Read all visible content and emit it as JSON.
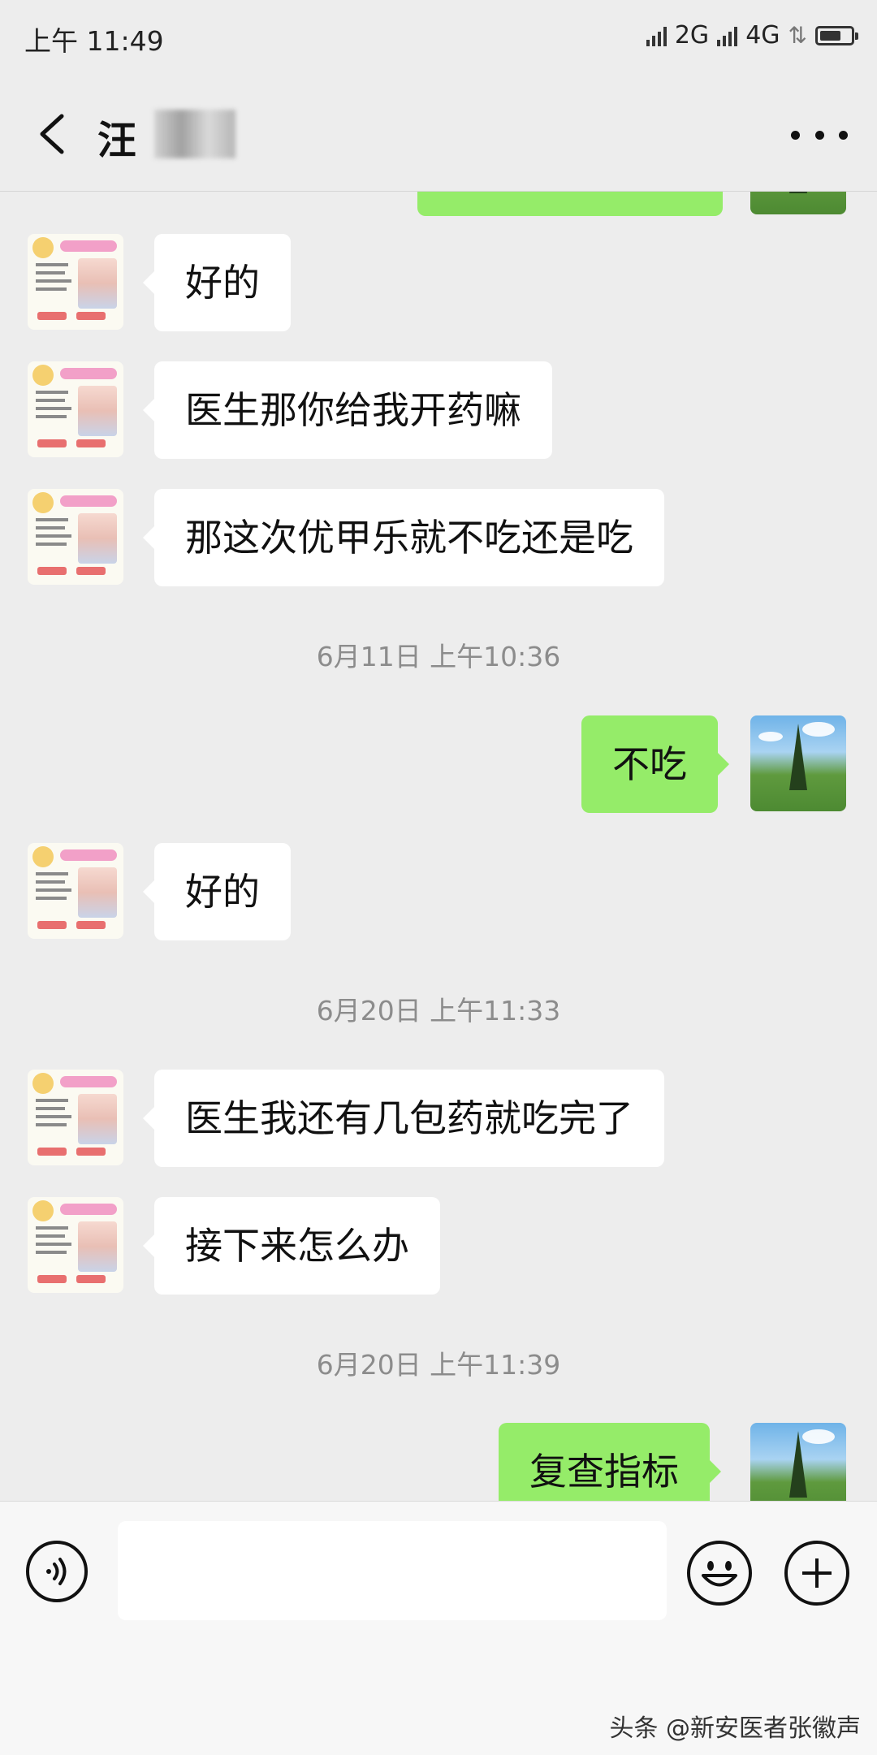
{
  "status_bar": {
    "time": "上午 11:49",
    "network_1": "2G",
    "network_2": "4G"
  },
  "header": {
    "contact_name": "汪",
    "back_icon": "chevron-left-icon",
    "more_icon": "more-horizontal-icon"
  },
  "messages": [
    {
      "side": "in",
      "text": "好的"
    },
    {
      "side": "in",
      "text": "医生那你给我开药嘛"
    },
    {
      "side": "in",
      "text": "那这次优甲乐就不吃还是吃"
    },
    {
      "type": "timestamp",
      "text": "6月11日 上午10:36"
    },
    {
      "side": "out",
      "text": "不吃"
    },
    {
      "side": "in",
      "text": "好的"
    },
    {
      "type": "timestamp",
      "text": "6月20日 上午11:33"
    },
    {
      "side": "in",
      "text": "医生我还有几包药就吃完了"
    },
    {
      "side": "in",
      "text": "接下来怎么办"
    },
    {
      "type": "timestamp",
      "text": "6月20日 上午11:39"
    },
    {
      "side": "out",
      "text": "复查指标"
    }
  ],
  "input_bar": {
    "voice_icon": "voice-icon",
    "emoji_icon": "emoji-icon",
    "plus_icon": "plus-icon",
    "message_value": ""
  },
  "watermark": "头条 @新安医者张徽声",
  "colors": {
    "background": "#ededed",
    "outgoing_bubble": "#95ec69",
    "incoming_bubble": "#ffffff"
  }
}
